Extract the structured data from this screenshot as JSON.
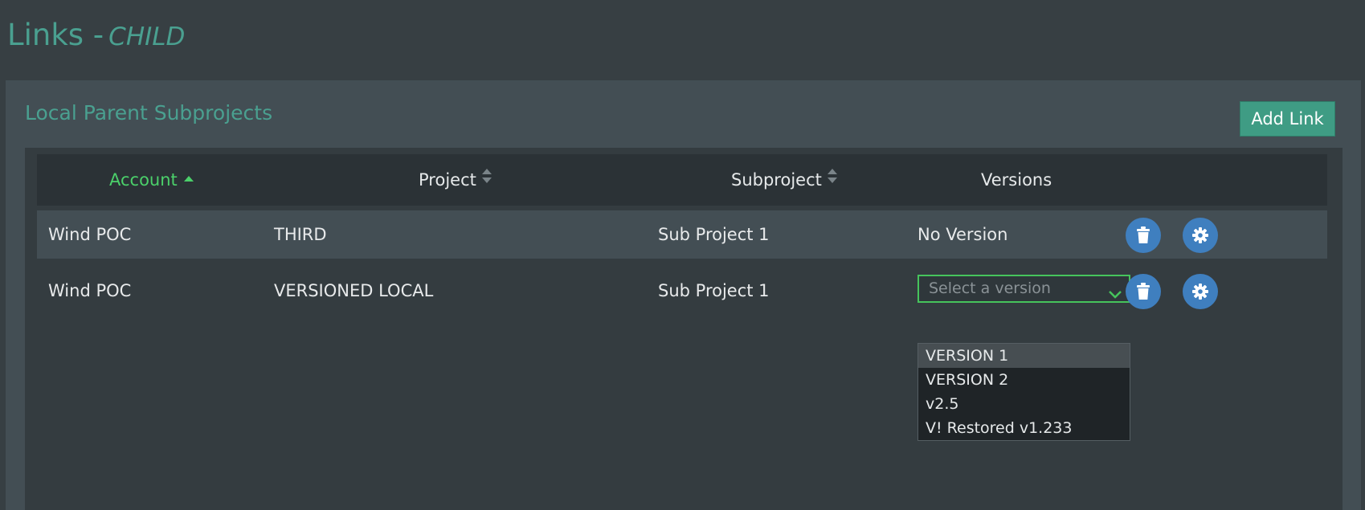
{
  "header": {
    "title": "Links -",
    "subtitle": "CHILD"
  },
  "panel": {
    "title": "Local Parent Subprojects",
    "add_button_label": "Add Link"
  },
  "table": {
    "columns": [
      {
        "label": "Account",
        "sort": "ascending",
        "active": true
      },
      {
        "label": "Project",
        "sort": "none",
        "active": false
      },
      {
        "label": "Subproject",
        "sort": "none",
        "active": false
      },
      {
        "label": "Versions",
        "sort": null,
        "active": false
      }
    ],
    "rows": [
      {
        "account": "Wind POC",
        "project": "THIRD",
        "subproject": "Sub Project 1",
        "version": "No Version"
      },
      {
        "account": "Wind POC",
        "project": "VERSIONED LOCAL",
        "subproject": "Sub Project 1",
        "version_select": {
          "placeholder": "Select a version",
          "options": [
            "VERSION 1",
            "VERSION 2",
            "v2.5",
            "V! Restored v1.233"
          ],
          "highlighted": "VERSION 1",
          "open": true
        }
      }
    ]
  },
  "icons": {
    "delete": "trash-icon",
    "settings": "gear-icon",
    "sort_asc": "sort-ascending-icon",
    "sort_both": "sort-icon",
    "chevron": "chevron-down-icon"
  },
  "colors": {
    "accent": "#4aa090",
    "active_sort": "#4bd06a",
    "button_teal": "#3f9c84",
    "icon_button_blue": "#3f7fbf",
    "select_focus": "#46c45c"
  }
}
